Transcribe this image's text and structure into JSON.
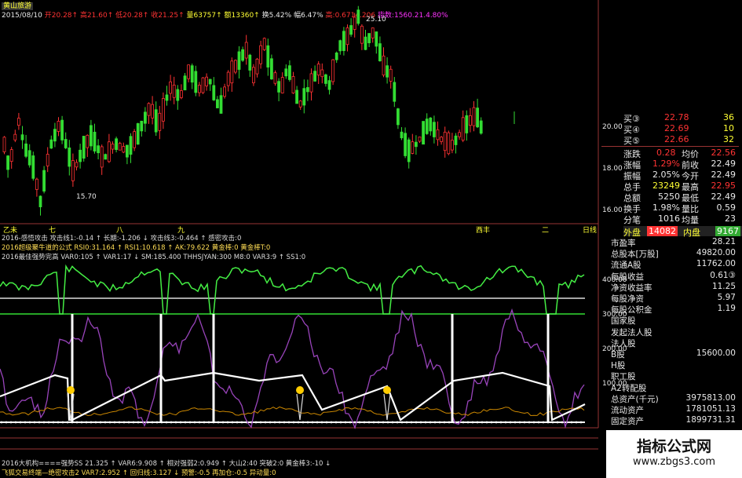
{
  "header": {
    "stock_name": "黄山旅游",
    "date": "2015/08/10",
    "open": "开20.28↑",
    "high": "高21.60↑",
    "low": "低20.28↑",
    "close": "收21.25↑",
    "volume": "量63757↑",
    "amount": "额13360↑",
    "turnover": "换5.42%",
    "amplitude": "幅6.47%",
    "index": "高:0.6714.206",
    "extra": "指数:1560.21.4.80%"
  },
  "main_chart": {
    "high_mark": "25.10",
    "low_mark": "15.70",
    "price_axis": [
      "20.00",
      "18.00",
      "16.00"
    ],
    "time_labels": [
      "乙未",
      "七",
      "八",
      "九",
      "西丰",
      "二",
      "日线"
    ]
  },
  "indicator_lines": {
    "line1": "2016-感悟攻击  攻击线1:-0.14 ↑  长期:-1.206 ↓  攻击线3:-0.464 ↑  感密攻击:0",
    "line2": "2016超级聚牛道的公式  RSI0:31.164 ↑  RSI1:10.618 ↑  AK:79.622  黄金棒:0  黄金棒T:0",
    "line3": "2016最佳强势完高  VAR0:105 ↑  VAR1:17 ↓  SM:185.400  THHSJYAN:300  M8:0  VAR3:9 ↑  SS1:0"
  },
  "sub_axis": [
    "400.00",
    "300.00",
    "200.00",
    "100.00"
  ],
  "bottom": {
    "line1": "2016大机构====强势SS  21.325 ↑  VAR6:9.908 ↑  相对强弱2:0.949 ↑  大山2:40  突破2:0  黄金棒3:-10 ↓",
    "line2": "飞狐交易终端—绝密攻击2  VAR7:2.952 ↑  回归线:3.127 ↓  预警:-0.5  再加仓:-0.5  异动量:0"
  },
  "quotes": {
    "buy3": {
      "label": "买③",
      "price": "22.78",
      "vol": "36"
    },
    "buy4": {
      "label": "买④",
      "price": "22.69",
      "vol": "10"
    },
    "buy5": {
      "label": "买⑤",
      "price": "22.66",
      "vol": "32"
    },
    "change": {
      "label": "涨跌",
      "value": "0.28",
      "label2": "均价",
      "value2": "22.56"
    },
    "pct": {
      "label": "涨幅",
      "value": "1.29%",
      "label2": "前收",
      "value2": "22.49"
    },
    "amp": {
      "label": "振幅",
      "value": "2.05%",
      "label2": "今开",
      "value2": "22.49"
    },
    "hands": {
      "label": "总手",
      "value": "23249",
      "label2": "最高",
      "value2": "22.95"
    },
    "amount": {
      "label": "总额",
      "value": "5250",
      "label2": "最低",
      "value2": "22.49"
    },
    "turnover": {
      "label": "换手",
      "value": "1.98%",
      "label2": "量比",
      "value2": "0.59"
    },
    "stroke": {
      "label": "分笔",
      "value": "1016",
      "label2": "均量",
      "value2": "23"
    },
    "outer": {
      "label": "外盘",
      "value": "14082",
      "label2": "内盘",
      "value2": "9167"
    }
  },
  "fundamentals": [
    {
      "label": "市盈率",
      "value": "28.21"
    },
    {
      "label": "总股本[万股]",
      "value": "49820.00"
    },
    {
      "label": "流通A股",
      "value": "11762.00"
    },
    {
      "label": "每股收益",
      "value": "0.61③"
    },
    {
      "label": "净资收益率",
      "value": "11.25"
    },
    {
      "label": "每股净资",
      "value": "5.97"
    },
    {
      "label": "每股公积金",
      "value": "1.19"
    },
    {
      "label": "国家股",
      "value": ""
    },
    {
      "label": "发起法人股",
      "value": ""
    },
    {
      "label": "法人股",
      "value": ""
    },
    {
      "label": "B股",
      "value": "15600.00"
    },
    {
      "label": "H股",
      "value": ""
    },
    {
      "label": "职工股",
      "value": ""
    },
    {
      "label": "A2转配股",
      "value": ""
    },
    {
      "label": "总资产(千元)",
      "value": "3975813.00"
    },
    {
      "label": "流动资产",
      "value": "1781051.13"
    },
    {
      "label": "固定资产",
      "value": "1899731.31"
    }
  ],
  "watermark": {
    "title": "指标公式网",
    "url": "www.zbgs3.com"
  },
  "colors": {
    "up": "#ff3333",
    "down": "#33dd33",
    "axis": "#993333",
    "accent": "#ffff33"
  }
}
